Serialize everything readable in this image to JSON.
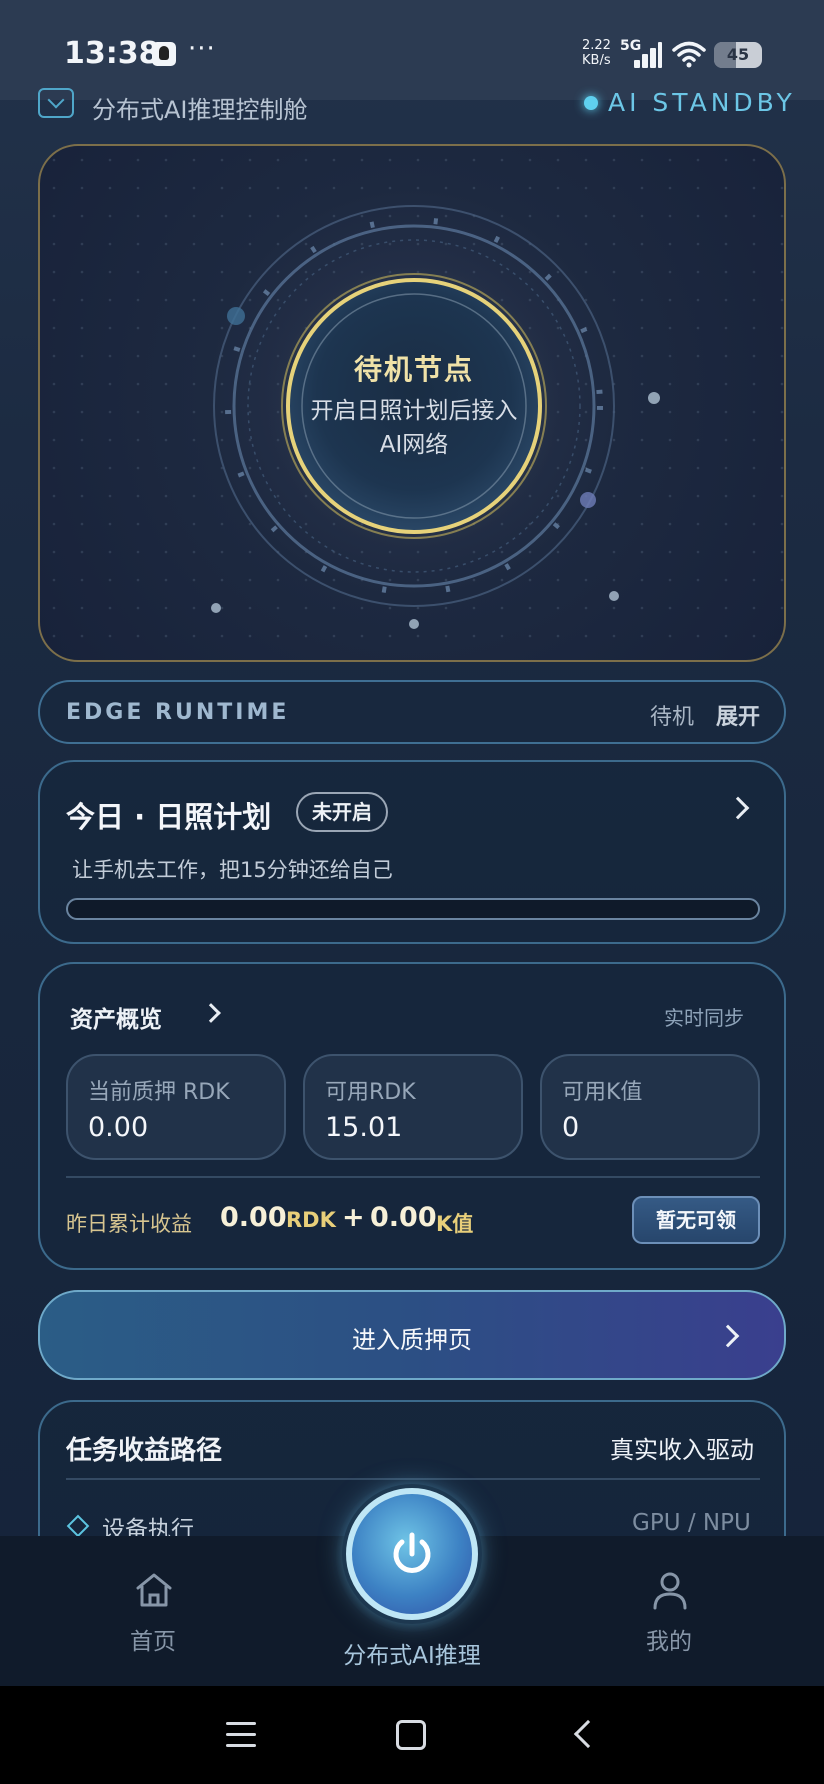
{
  "status_bar": {
    "time": "13:38",
    "more": "···",
    "net_speed_value": "2.22",
    "net_speed_unit": "KB/s",
    "network": "5G",
    "battery": "45"
  },
  "header": {
    "title": "分布式AI推理控制舱",
    "status": "AI STANDBY"
  },
  "hero": {
    "title": "待机节点",
    "subtitle": "开启日照计划后接入AI网络"
  },
  "runtime": {
    "label": "EDGE RUNTIME",
    "state": "待机",
    "expand": "展开"
  },
  "plan": {
    "title": "今日 · 日照计划",
    "badge": "未开启",
    "subtitle": "让手机去工作，把15分钟还给自己",
    "progress": 0
  },
  "assets": {
    "title": "资产概览",
    "sync": "实时同步",
    "tiles": [
      {
        "label": "当前质押 RDK",
        "value": "0.00"
      },
      {
        "label": "可用RDK",
        "value": "15.01"
      },
      {
        "label": "可用K值",
        "value": "0"
      }
    ],
    "earn_label": "昨日累计收益",
    "earn_rdk": "0.00",
    "earn_rdk_unit": "RDK",
    "plus": "+",
    "earn_k": "0.00",
    "earn_k_unit": "K值",
    "claim_label": "暂无可领"
  },
  "stake": {
    "label": "进入质押页"
  },
  "task_path": {
    "title": "任务收益路径",
    "right": "真实收入驱动",
    "items": [
      {
        "label": "设备执行",
        "value": "GPU / NPU"
      }
    ]
  },
  "nav": {
    "home": "首页",
    "ai": "分布式AI推理",
    "me": "我的"
  },
  "colors": {
    "accent_cyan": "#5fd0ef",
    "gold": "#e8cf7a",
    "background": "#18273d"
  }
}
